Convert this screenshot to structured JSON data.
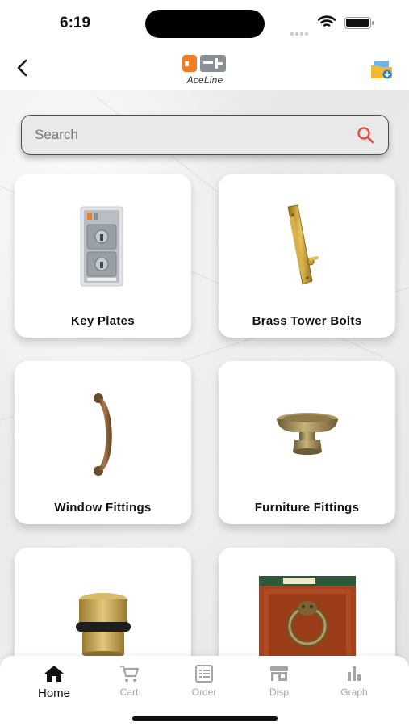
{
  "status_bar": {
    "time": "6:19"
  },
  "header": {
    "logo_text": "AceLine",
    "brand_colors": {
      "orange": "#ef7d22",
      "gray": "#8a8f95"
    }
  },
  "search": {
    "placeholder": "Search",
    "value": "",
    "icon": "search-icon",
    "icon_color": "#e2513a"
  },
  "categories": [
    {
      "label": "Key Plates"
    },
    {
      "label": "Brass Tower Bolts"
    },
    {
      "label": "Window Fittings"
    },
    {
      "label": "Furniture Fittings"
    },
    {
      "label": ""
    },
    {
      "label": ""
    }
  ],
  "nav": {
    "items": [
      {
        "label": "Home",
        "icon": "home-icon",
        "active": true
      },
      {
        "label": "Cart",
        "icon": "cart-icon",
        "active": false
      },
      {
        "label": "Order",
        "icon": "order-icon",
        "active": false
      },
      {
        "label": "Disp",
        "icon": "store-icon",
        "active": false
      },
      {
        "label": "Graph",
        "icon": "graph-icon",
        "active": false
      }
    ]
  }
}
